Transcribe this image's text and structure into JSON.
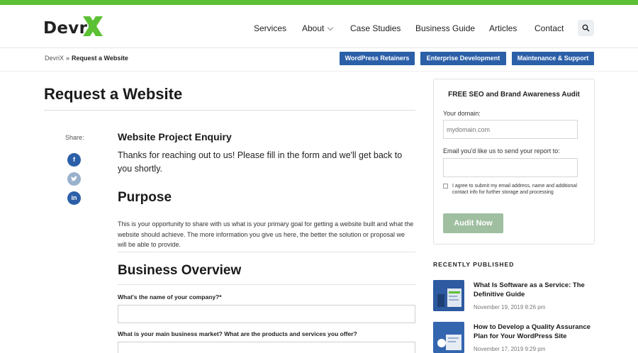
{
  "brand": {
    "name": "Devri",
    "accent": "#5cc034",
    "primary": "#2b5fa8"
  },
  "nav": {
    "items": [
      "Services",
      "About",
      "Case Studies",
      "Business Guide",
      "Articles",
      "Contact"
    ]
  },
  "breadcrumb": {
    "home": "DevriX",
    "separator": "»",
    "current": "Request a Website"
  },
  "pills": [
    "WordPress Retainers",
    "Enterprise Development",
    "Maintenance & Support"
  ],
  "page": {
    "title": "Request a Website",
    "share_label": "Share:",
    "enquiry_title": "Website Project Enquiry",
    "enquiry_body": "Thanks for reaching out to us! Please fill in the form and we'll get back to you shortly.",
    "purpose_heading": "Purpose",
    "purpose_text": "This is your opportunity to share with us what is your primary goal for getting a website built and what the website should achieve. The more information you give us here, the better the solution or proposal we will be able to provide.",
    "business_heading": "Business Overview",
    "q1_label": "What's the name of your company?*",
    "q2_label": "What is your main business market? What are the products and services you offer?"
  },
  "audit": {
    "title": "FREE SEO and Brand Awareness Audit",
    "domain_label": "Your domain:",
    "domain_placeholder": "mydomain.com",
    "email_label": "Email you'd like us to send your report to:",
    "consent": "I agree to submit my email address, name and additional contact info for further storage and processing",
    "button": "Audit Now"
  },
  "recent": {
    "heading": "RECENTLY PUBLISHED",
    "posts": [
      {
        "title": "What Is Software as a Service: The Definitive Guide",
        "date": "November 19, 2019 8:26 pm"
      },
      {
        "title": "How to Develop a Quality Assurance Plan for Your WordPress Site",
        "date": "November 17, 2019 9:29 pm"
      }
    ]
  },
  "icons": [
    "search-icon",
    "facebook-icon",
    "twitter-icon",
    "linkedin-icon",
    "chevron-down-icon"
  ]
}
